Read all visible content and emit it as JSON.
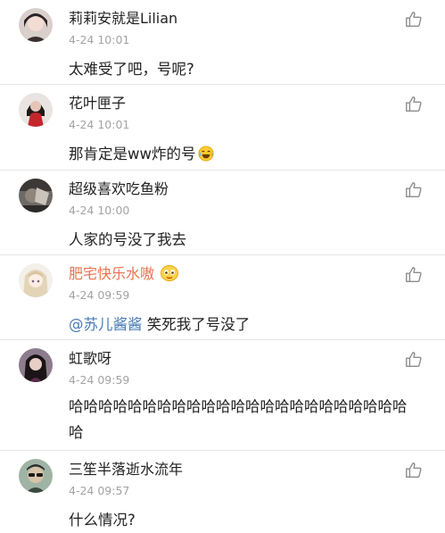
{
  "comments": [
    {
      "username": "莉莉安就是Lilian",
      "time": "4-24 10:01",
      "text": "太难受了吧，号呢?",
      "avatar_icon": "avatar-girl-icon"
    },
    {
      "username": "花叶匣子",
      "time": "4-24 10:01",
      "text": "那肯定是ww炸的号",
      "emoji": "laughing-emoji-icon",
      "avatar_icon": "avatar-red-dress-icon"
    },
    {
      "username": "超级喜欢吃鱼粉",
      "time": "4-24 10:00",
      "text": "人家的号没了我去",
      "avatar_icon": "avatar-photo-icon"
    },
    {
      "username": "肥宅快乐水嗷",
      "time": "4-24 09:59",
      "mention": "@苏儿酱酱",
      "text": " 笑死我了号没了",
      "badge_icon": "vip-fan-badge-icon",
      "name_color": "#eb7350",
      "avatar_icon": "avatar-anime-icon"
    },
    {
      "username": "虹歌呀",
      "time": "4-24 09:59",
      "text": "哈哈哈哈哈哈哈哈哈哈哈哈哈哈哈哈哈哈哈哈哈哈哈哈",
      "avatar_icon": "avatar-dark-hair-icon"
    },
    {
      "username": "三笙半落逝水流年",
      "time": "4-24 09:57",
      "text": "什么情况?",
      "avatar_icon": "avatar-sunglasses-icon"
    }
  ],
  "like_icon": "thumbs-up-icon",
  "colors": {
    "timestamp": "#a3a3a3",
    "mention": "#4a7bb7",
    "highlight_name": "#eb7350",
    "divider": "#e6e6e6"
  }
}
